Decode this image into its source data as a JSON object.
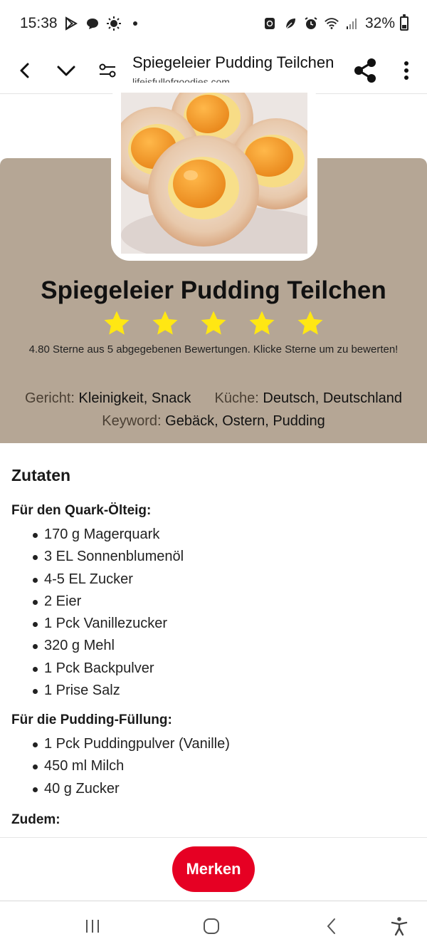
{
  "status_bar": {
    "time": "15:38",
    "battery": "32%"
  },
  "browser": {
    "title": "Spiegeleier Pudding Teilchen",
    "url": "lifeisfullofgoodies.com"
  },
  "recipe": {
    "title": "Spiegeleier Pudding Teilchen",
    "rating": 4.8,
    "stars_max": 5,
    "rating_text": "4.80 Sterne aus 5 abgegebenen Bewertungen. Klicke Sterne um zu bewerten!",
    "meta": {
      "gericht_label": "Gericht:",
      "gericht_value": "Kleinigkeit, Snack",
      "kueche_label": "Küche:",
      "kueche_value": "Deutsch, Deutschland",
      "keyword_label": "Keyword:",
      "keyword_value": "Gebäck, Ostern, Pudding"
    }
  },
  "ingredients": {
    "heading": "Zutaten",
    "groups": [
      {
        "title": "Für den Quark-Ölteig:",
        "items": [
          "170 g Magerquark",
          "3 EL Sonnenblumenöl",
          "4-5 EL Zucker",
          "2 Eier",
          "1 Pck Vanillezucker",
          "320 g Mehl",
          "1 Pck Backpulver",
          "1 Prise Salz"
        ]
      },
      {
        "title": "Für die Pudding-Füllung:",
        "items": [
          "1 Pck Puddingpulver (Vanille)",
          "450 ml Milch",
          "40 g Zucker"
        ]
      },
      {
        "title": "Zudem:",
        "items": []
      }
    ]
  },
  "actions": {
    "save_label": "Merken"
  },
  "colors": {
    "card_bg": "#b5a695",
    "star": "#ffe713",
    "save_button": "#e60023"
  }
}
